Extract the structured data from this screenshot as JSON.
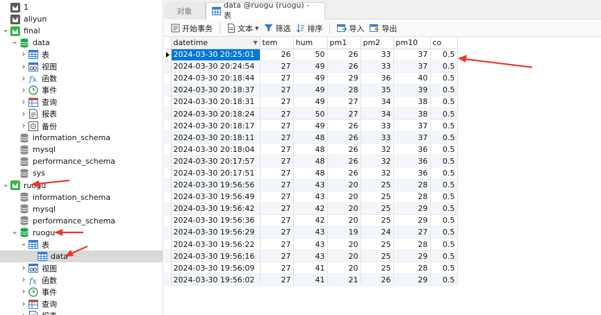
{
  "tree": [
    {
      "label": "1",
      "icon": "conn-icon",
      "level": 0,
      "chev": ""
    },
    {
      "label": "aliyun",
      "icon": "conn-icon",
      "level": 0,
      "chev": ""
    },
    {
      "label": "final",
      "icon": "conn-open-icon",
      "level": 0,
      "chev": "open"
    },
    {
      "label": "data",
      "icon": "db-open-icon",
      "level": 1,
      "chev": "open"
    },
    {
      "label": "表",
      "icon": "table-icon",
      "level": 2,
      "chev": "closed"
    },
    {
      "label": "视图",
      "icon": "view-icon",
      "level": 2,
      "chev": "closed"
    },
    {
      "label": "函数",
      "icon": "function-icon",
      "level": 2,
      "chev": "closed"
    },
    {
      "label": "事件",
      "icon": "event-icon",
      "level": 2,
      "chev": "closed"
    },
    {
      "label": "查询",
      "icon": "query-icon",
      "level": 2,
      "chev": "closed"
    },
    {
      "label": "报表",
      "icon": "report-icon",
      "level": 2,
      "chev": "closed"
    },
    {
      "label": "备份",
      "icon": "backup-icon",
      "level": 2,
      "chev": "closed"
    },
    {
      "label": "information_schema",
      "icon": "db-icon",
      "level": 1,
      "chev": ""
    },
    {
      "label": "mysql",
      "icon": "db-icon",
      "level": 1,
      "chev": ""
    },
    {
      "label": "performance_schema",
      "icon": "db-icon",
      "level": 1,
      "chev": ""
    },
    {
      "label": "sys",
      "icon": "db-icon",
      "level": 1,
      "chev": ""
    },
    {
      "label": "ruogu",
      "icon": "conn-open-icon",
      "level": 0,
      "chev": "open"
    },
    {
      "label": "information_schema",
      "icon": "db-icon",
      "level": 1,
      "chev": ""
    },
    {
      "label": "mysql",
      "icon": "db-icon",
      "level": 1,
      "chev": ""
    },
    {
      "label": "performance_schema",
      "icon": "db-icon",
      "level": 1,
      "chev": ""
    },
    {
      "label": "ruogu",
      "icon": "db-open-icon",
      "level": 1,
      "chev": "open"
    },
    {
      "label": "表",
      "icon": "table-icon",
      "level": 2,
      "chev": "open"
    },
    {
      "label": "data",
      "icon": "table-icon",
      "level": 3,
      "chev": "",
      "selected": true
    },
    {
      "label": "视图",
      "icon": "view-icon",
      "level": 2,
      "chev": "closed"
    },
    {
      "label": "函数",
      "icon": "function-icon",
      "level": 2,
      "chev": "closed"
    },
    {
      "label": "事件",
      "icon": "event-icon",
      "level": 2,
      "chev": "closed"
    },
    {
      "label": "查询",
      "icon": "query-icon",
      "level": 2,
      "chev": "closed"
    },
    {
      "label": "报表",
      "icon": "report-icon",
      "level": 2,
      "chev": "closed"
    }
  ],
  "tabs": {
    "objects_label": "对象",
    "active_label": "data @ruogu (ruogu) - 表"
  },
  "toolbar": {
    "begin_transaction": "开始事务",
    "text": "文本",
    "filter": "筛选",
    "sort": "排序",
    "import": "导入",
    "export": "导出"
  },
  "grid": {
    "columns": [
      "datetime",
      "tem",
      "hum",
      "pm1",
      "pm2",
      "pm10",
      "co"
    ],
    "rows": [
      [
        "2024-03-30 20:25:01",
        "26",
        "50",
        "26",
        "33",
        "37",
        "0.5"
      ],
      [
        "2024-03-30 20:24:54",
        "27",
        "49",
        "26",
        "33",
        "37",
        "0.5"
      ],
      [
        "2024-03-30 20:18:44",
        "27",
        "49",
        "29",
        "36",
        "40",
        "0.5"
      ],
      [
        "2024-03-30 20:18:37",
        "27",
        "49",
        "28",
        "35",
        "39",
        "0.5"
      ],
      [
        "2024-03-30 20:18:31",
        "27",
        "49",
        "27",
        "34",
        "38",
        "0.5"
      ],
      [
        "2024-03-30 20:18:24",
        "27",
        "50",
        "27",
        "34",
        "38",
        "0.5"
      ],
      [
        "2024-03-30 20:18:17",
        "27",
        "49",
        "26",
        "33",
        "37",
        "0.5"
      ],
      [
        "2024-03-30 20:18:11",
        "27",
        "48",
        "26",
        "33",
        "37",
        "0.5"
      ],
      [
        "2024-03-30 20:18:04",
        "27",
        "48",
        "26",
        "32",
        "36",
        "0.5"
      ],
      [
        "2024-03-30 20:17:57",
        "27",
        "48",
        "26",
        "32",
        "36",
        "0.5"
      ],
      [
        "2024-03-30 20:17:51",
        "27",
        "48",
        "26",
        "32",
        "36",
        "0.5"
      ],
      [
        "2024-03-30 19:56:56",
        "27",
        "43",
        "20",
        "25",
        "28",
        "0.5"
      ],
      [
        "2024-03-30 19:56:49",
        "27",
        "43",
        "20",
        "25",
        "28",
        "0.5"
      ],
      [
        "2024-03-30 19:56:42",
        "27",
        "42",
        "20",
        "25",
        "29",
        "0.5"
      ],
      [
        "2024-03-30 19:56:36",
        "27",
        "42",
        "20",
        "25",
        "29",
        "0.5"
      ],
      [
        "2024-03-30 19:56:29",
        "27",
        "43",
        "19",
        "24",
        "27",
        "0.5"
      ],
      [
        "2024-03-30 19:56:22",
        "27",
        "43",
        "20",
        "25",
        "28",
        "0.5"
      ],
      [
        "2024-03-30 19:56:16",
        "27",
        "43",
        "20",
        "25",
        "29",
        "0.5"
      ],
      [
        "2024-03-30 19:56:09",
        "27",
        "41",
        "20",
        "25",
        "28",
        "0.5"
      ],
      [
        "2024-03-30 19:56:02",
        "27",
        "41",
        "21",
        "26",
        "29",
        "0.5"
      ]
    ]
  },
  "colors": {
    "accent": "#0078d7",
    "annotation_arrow": "#e8392b",
    "db_green": "#22a447",
    "conn_green": "#3bb34a"
  }
}
